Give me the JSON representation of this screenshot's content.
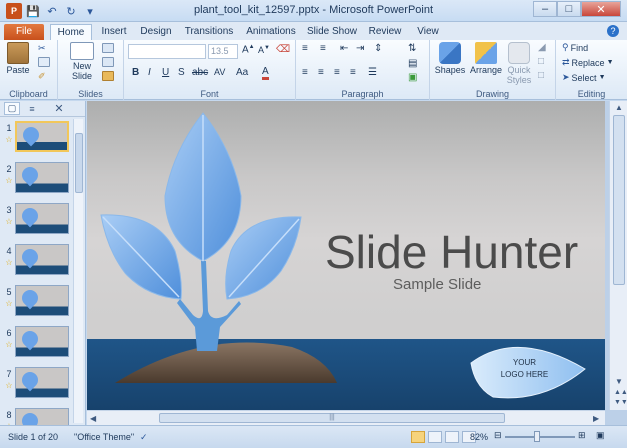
{
  "window": {
    "title": "plant_tool_kit_12597.pptx - Microsoft PowerPoint",
    "qat_icons": [
      "powerpoint-icon",
      "save-icon",
      "undo-icon",
      "redo-icon",
      "customize-icon"
    ],
    "controls": [
      "minimize",
      "maximize",
      "close"
    ]
  },
  "tabs": [
    "File",
    "Home",
    "Insert",
    "Design",
    "Transitions",
    "Animations",
    "Slide Show",
    "Review",
    "View"
  ],
  "active_tab": "Home",
  "ribbon": {
    "clipboard": {
      "paste": "Paste",
      "label": "Clipboard"
    },
    "slides": {
      "new_slide": "New Slide",
      "label": "Slides"
    },
    "font": {
      "font_name": "",
      "font_size": "13.5",
      "label": "Font"
    },
    "paragraph": {
      "label": "Paragraph"
    },
    "drawing": {
      "shapes": "Shapes",
      "arrange": "Arrange",
      "quick_styles": "Quick Styles",
      "label": "Drawing"
    },
    "editing": {
      "find": "Find",
      "replace": "Replace",
      "select": "Select",
      "label": "Editing"
    }
  },
  "thumbnails": [
    {
      "num": "1",
      "selected": true
    },
    {
      "num": "2",
      "selected": false
    },
    {
      "num": "3",
      "selected": false
    },
    {
      "num": "4",
      "selected": false
    },
    {
      "num": "5",
      "selected": false
    },
    {
      "num": "6",
      "selected": false
    },
    {
      "num": "7",
      "selected": false
    },
    {
      "num": "8",
      "selected": false
    }
  ],
  "slide": {
    "title": "Slide Hunter",
    "subtitle": "Sample Slide",
    "logo_line1": "YOUR",
    "logo_line2": "LOGO HERE"
  },
  "status": {
    "slide_info": "Slide 1 of 20",
    "theme": "\"Office Theme\"",
    "zoom": "82%"
  },
  "colors": {
    "accent": "#2b579a",
    "file_tab": "#d35f2a",
    "leaf": "#6aa3e8",
    "ground": "#1d4d79"
  }
}
